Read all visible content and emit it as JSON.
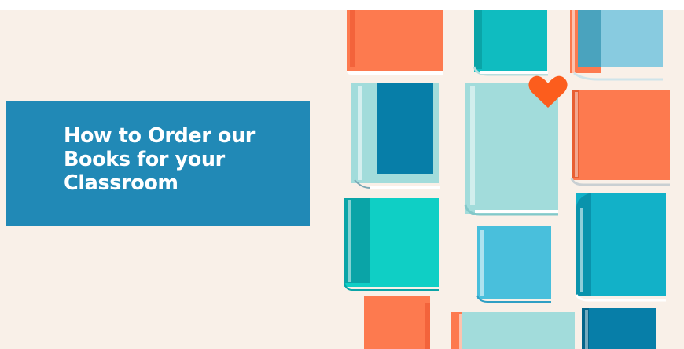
{
  "banner": {
    "title_lines": [
      "How to Order our",
      "Books for your",
      "Classroom"
    ]
  },
  "colors": {
    "background": "#f9f0e8",
    "title_band": "#2189b6",
    "title_text": "#ffffff",
    "coral": "#fd7a4f",
    "teal": "#0fbcc0",
    "light_blue": "#88cbe0",
    "mint": "#a2dcdb",
    "deep_blue": "#077ea8",
    "sky_blue": "#49bfdc",
    "heart": "#fc5d1d"
  },
  "icons": [
    "heart-icon"
  ]
}
